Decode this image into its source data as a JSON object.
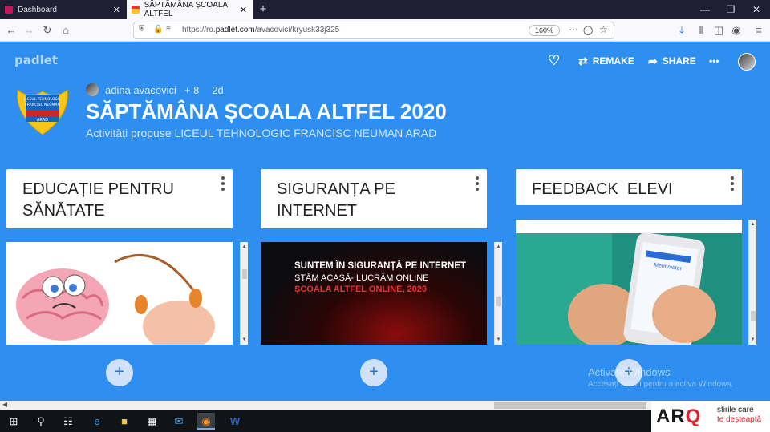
{
  "browser": {
    "tabs": [
      {
        "label": "Dashboard",
        "close": "✕"
      },
      {
        "label": "SĂPTĂMÂNA ȘCOALA ALTFEL",
        "close": "✕"
      }
    ],
    "new_tab": "+",
    "window_controls": {
      "minimize": "—",
      "restore": "❐",
      "close": "✕"
    },
    "url_prefix": "https://ro.",
    "url_domain": "padlet.com",
    "url_path": "/avacovici/kryusk33j325",
    "zoom": "160%"
  },
  "padlet": {
    "logo": "padlet",
    "remake_label": "REMAKE",
    "share_label": "SHARE",
    "more": "•••",
    "author": "adina avacovici",
    "contributors": "+ 8",
    "age": "2d",
    "title": "SĂPTĂMÂNA ȘCOALA ALTFEL 2020",
    "subtitle": "Activități propuse LICEUL TEHNOLOGIC FRANCISC NEUMAN ARAD",
    "crest_text": [
      "LICEUL TEHNOLOGIC",
      "FRANCISC NEUMAN",
      "ARAD"
    ]
  },
  "columns": [
    {
      "title": "EDUCAȚIE PENTRU SĂNĂTATE",
      "add": "+"
    },
    {
      "title": "SIGURANȚA PE INTERNET",
      "add": "+"
    },
    {
      "title": "FEEDBACK  ELEVI",
      "add": "+"
    }
  ],
  "card2_text": [
    "SUNTEM ÎN SIGURANȚĂ PE INTERNET",
    "STĂM ACASĂ- LUCRĂM ONLINE",
    "ȘCOALA ALTFEL ONLINE, 2020"
  ],
  "card3_app_label": "Mentimeter",
  "windows": {
    "activate_title": "Activate Windows",
    "activate_sub": "Accesați Setări pentru a activa Windows."
  },
  "arq": {
    "logo_ar": "AR",
    "logo_q": "Q",
    "tag_line1": "știrile care",
    "tag_line2": "te deșteaptă"
  },
  "colors": {
    "background": "#2e8ff0",
    "accent_red": "#e2232a"
  }
}
